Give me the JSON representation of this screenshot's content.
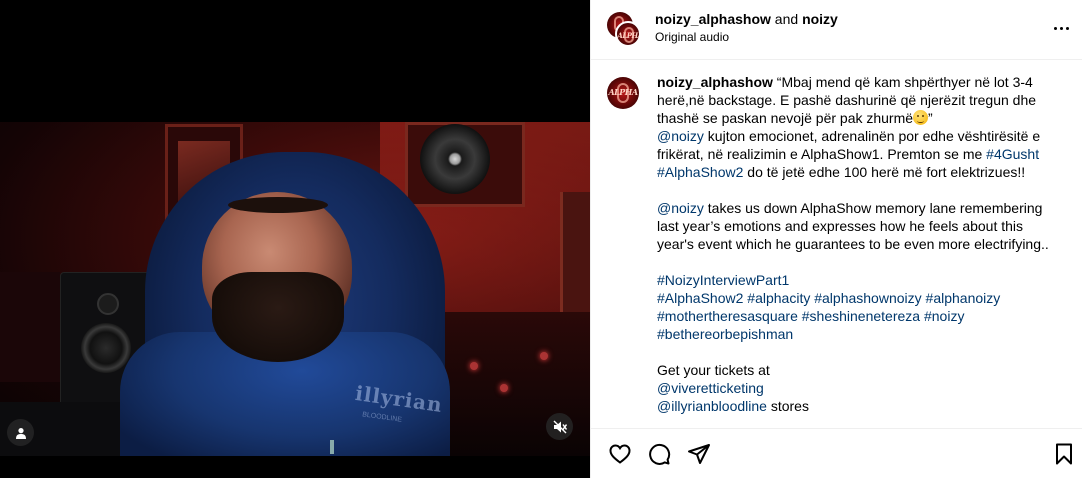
{
  "post": {
    "header": {
      "author": "noizy_alphashow",
      "connector": " and ",
      "coauthor": "noizy",
      "audio": "Original audio",
      "avatar_text": "ALPHA"
    },
    "caption": {
      "username": "noizy_alphashow",
      "line1": " “Mbaj mend që kam shpërthyer në lot 3-4 herë,në backstage. E pashë dashurinë që njerëzit tregun dhe thashë se paskan nevojë për pak zhurmë",
      "line1_end": "”",
      "mention1": "@noizy",
      "line2": " kujton emocionet, adrenalinën por edhe vështirësitë e frikërat, në realizimin e AlphaShow1. Premton se me ",
      "hashtag_4gusht": "#4Gusht",
      "hashtag_alphashow2_a": "#AlphaShow2",
      "line3": " do të jetë edhe 100 herë më fort elektrizues!!",
      "mention2": "@noizy",
      "line4": " takes us down AlphaShow memory lane remembering last year’s emotions and expresses how he feels about this year's event which he guarantees to be even more electrifying..",
      "hashtag_interview": "#NoizyInterviewPart1",
      "hashtags": [
        "#AlphaShow2",
        "#alphacity",
        "#alphashownoizy",
        "#alphanoizy",
        "#mothertheresasquare",
        "#sheshinenetereza",
        "#noizy",
        "#bethereorbepishman"
      ],
      "tickets": "Get your tickets at",
      "mention_vivere": "@viveretticketing",
      "mention_illyrian": "@illyrianbloodline",
      "stores": " stores"
    },
    "video": {
      "hoodie_logo": "illyrian",
      "hoodie_sub": "BLOODLINE"
    }
  },
  "icons": {
    "tag": "person-tag-icon",
    "mute": "speaker-muted-icon",
    "more": "more-horizontal-icon",
    "like": "heart-icon",
    "comment": "comment-bubble-icon",
    "share": "paper-plane-icon",
    "save": "bookmark-icon"
  }
}
